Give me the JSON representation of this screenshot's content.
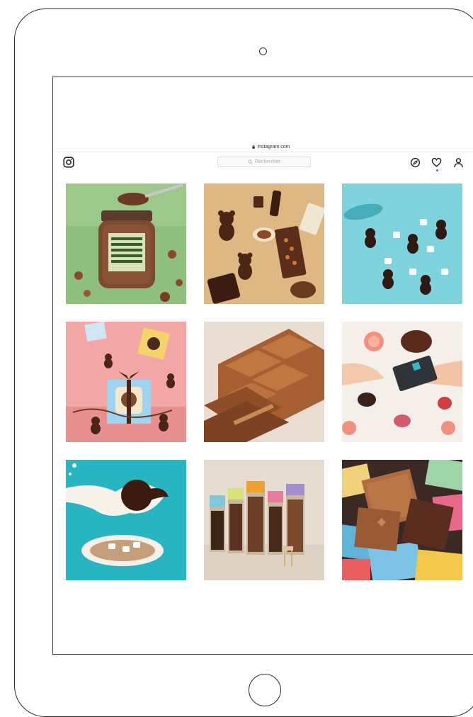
{
  "browser": {
    "url": "instagram.com"
  },
  "instagram": {
    "search_placeholder": "Rechercher"
  },
  "colors": {
    "notification": "#ed4956",
    "search_border": "#d6e1ea",
    "post_backgrounds": [
      "#8fbf7e",
      "#d9b27c",
      "#7fd3dc",
      "#f2a6a6",
      "#e9ddd2",
      "#f4efe9",
      "#27b6c1",
      "#e6ddd0",
      "#3b2a24"
    ]
  },
  "posts": [
    {
      "name": "post-hazelnut-spread-jar"
    },
    {
      "name": "post-chocolate-bears-bars"
    },
    {
      "name": "post-marshmallow-bears"
    },
    {
      "name": "post-gift-box-bears"
    },
    {
      "name": "post-milk-chocolate-bar"
    },
    {
      "name": "post-chocolate-gift-hands"
    },
    {
      "name": "post-hot-chocolate-bomb"
    },
    {
      "name": "post-chocolate-bar-packs"
    },
    {
      "name": "post-chocolate-squares"
    }
  ]
}
